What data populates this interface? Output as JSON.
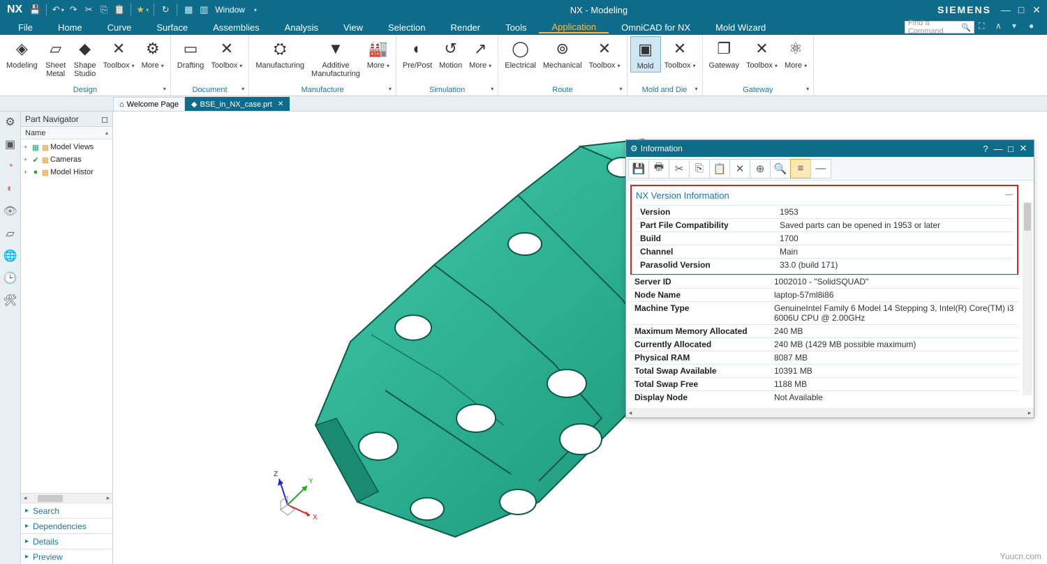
{
  "app": {
    "logo": "NX",
    "title": "NX - Modeling",
    "brand": "SIEMENS",
    "windowMenu": "Window"
  },
  "menubar": {
    "items": [
      "File",
      "Home",
      "Curve",
      "Surface",
      "Assemblies",
      "Analysis",
      "View",
      "Selection",
      "Render",
      "Tools",
      "Application",
      "OmniCAD for NX",
      "Mold Wizard"
    ],
    "activeIndex": 10,
    "findPlaceholder": "Find a Command"
  },
  "ribbon": {
    "groups": [
      {
        "label": "Design",
        "buttons": [
          {
            "name": "modeling",
            "label": "Modeling",
            "glyph": "◈"
          },
          {
            "name": "sheet-metal",
            "label": "Sheet\nMetal",
            "glyph": "▱"
          },
          {
            "name": "shape-studio",
            "label": "Shape\nStudio",
            "glyph": "◆"
          },
          {
            "name": "toolbox",
            "label": "Toolbox",
            "glyph": "✕",
            "dd": true
          },
          {
            "name": "more",
            "label": "More",
            "glyph": "⚙",
            "dd": true
          }
        ]
      },
      {
        "label": "Document",
        "buttons": [
          {
            "name": "drafting",
            "label": "Drafting",
            "glyph": "▭"
          },
          {
            "name": "toolbox",
            "label": "Toolbox",
            "glyph": "✕",
            "dd": true
          }
        ]
      },
      {
        "label": "Manufacture",
        "buttons": [
          {
            "name": "manufacturing",
            "label": "Manufacturing",
            "glyph": "⛭"
          },
          {
            "name": "additive-manufacturing",
            "label": "Additive\nManufacturing",
            "glyph": "▼"
          },
          {
            "name": "more",
            "label": "More",
            "glyph": "🏭",
            "dd": true
          }
        ]
      },
      {
        "label": "Simulation",
        "buttons": [
          {
            "name": "pre-post",
            "label": "Pre/Post",
            "glyph": "◐"
          },
          {
            "name": "motion",
            "label": "Motion",
            "glyph": "↺"
          },
          {
            "name": "more",
            "label": "More",
            "glyph": "↗",
            "dd": true
          }
        ]
      },
      {
        "label": "Route",
        "buttons": [
          {
            "name": "electrical",
            "label": "Electrical",
            "glyph": "◯"
          },
          {
            "name": "mechanical",
            "label": "Mechanical",
            "glyph": "⊚"
          },
          {
            "name": "toolbox",
            "label": "Toolbox",
            "glyph": "✕",
            "dd": true
          }
        ]
      },
      {
        "label": "Mold and Die",
        "buttons": [
          {
            "name": "mold",
            "label": "Mold",
            "glyph": "▣",
            "active": true
          },
          {
            "name": "toolbox",
            "label": "Toolbox",
            "glyph": "✕",
            "dd": true
          }
        ]
      },
      {
        "label": "Gateway",
        "buttons": [
          {
            "name": "gateway",
            "label": "Gateway",
            "glyph": "❐"
          },
          {
            "name": "toolbox",
            "label": "Toolbox",
            "glyph": "✕",
            "dd": true
          },
          {
            "name": "more",
            "label": "More",
            "glyph": "⚛",
            "dd": true
          }
        ]
      }
    ]
  },
  "doctabs": {
    "tabs": [
      {
        "label": "Welcome Page",
        "icon": "⌂",
        "active": false
      },
      {
        "label": "BSE_in_NX_case.prt",
        "icon": "◆",
        "active": true,
        "closable": true
      }
    ]
  },
  "navigator": {
    "title": "Part Navigator",
    "column": "Name",
    "rows": [
      {
        "twist": "+",
        "icon": "▦",
        "label": "Model Views",
        "color": "#2a7"
      },
      {
        "twist": "+",
        "icon": "✔",
        "label": "Cameras",
        "color": "#29a033"
      },
      {
        "twist": "+",
        "icon": "●",
        "label": "Model Histor",
        "color": "#29a033"
      }
    ],
    "accordions": [
      "Search",
      "Dependencies",
      "Details",
      "Preview"
    ]
  },
  "infoWindow": {
    "title": "Information",
    "heading": "NX Version Information",
    "boxedRows": [
      {
        "k": "Version",
        "v": "1953"
      },
      {
        "k": "Part File Compatibility",
        "v": "Saved parts can be opened in 1953 or later"
      },
      {
        "k": "Build",
        "v": "1700"
      },
      {
        "k": "Channel",
        "v": "Main"
      },
      {
        "k": "Parasolid Version",
        "v": "33.0 (build 171)"
      }
    ],
    "rows": [
      {
        "k": "Server ID",
        "v": "1002010 - \"SolidSQUAD\""
      },
      {
        "k": "Node Name",
        "v": "laptop-57ml8i86"
      },
      {
        "k": "Machine Type",
        "v": "GenuineIntel Family 6 Model 14 Stepping 3, Intel(R) Core(TM) i3 6006U CPU @ 2.00GHz"
      },
      {
        "k": "Maximum Memory Allocated",
        "v": "240 MB"
      },
      {
        "k": "Currently Allocated",
        "v": "240 MB (1429 MB possible maximum)"
      },
      {
        "k": "Physical RAM",
        "v": "8087 MB"
      },
      {
        "k": "Total Swap Available",
        "v": "10391 MB"
      },
      {
        "k": "Total Swap Free",
        "v": "1188 MB"
      },
      {
        "k": "Display Node",
        "v": "Not Available"
      }
    ]
  },
  "triad": {
    "x": "X",
    "y": "Y",
    "z": "Z"
  },
  "watermark": "Yuucn.com"
}
